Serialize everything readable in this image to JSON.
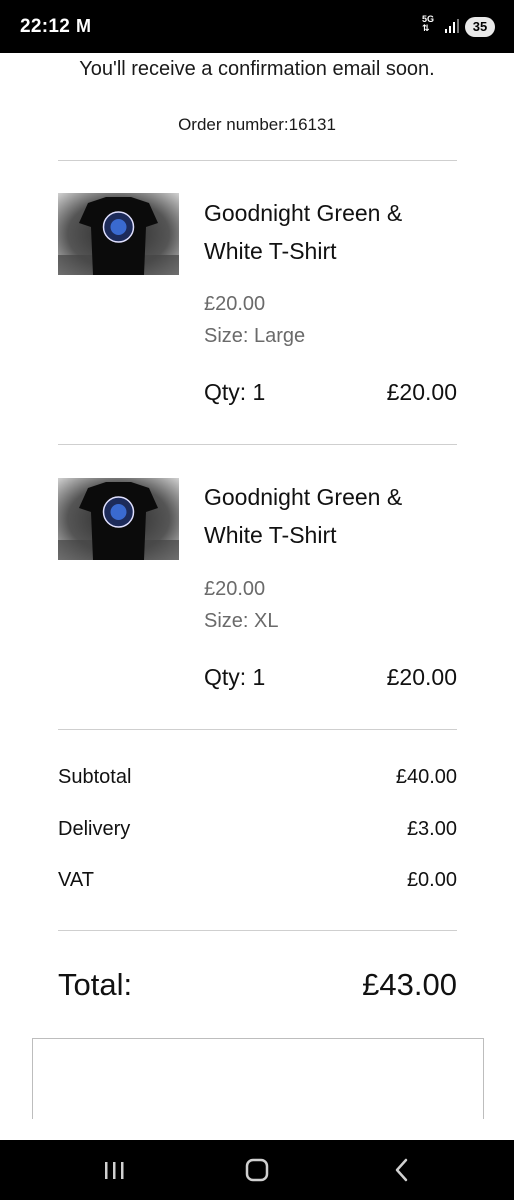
{
  "status_bar": {
    "time": "22:12",
    "notification_glyph": "M",
    "network": "5G",
    "battery": "35",
    "icons": [
      "gmail-icon",
      "signal-icon",
      "battery-icon"
    ]
  },
  "confirmation": {
    "message": "You'll receive a confirmation email soon.",
    "order_number_text": "Order number:16131"
  },
  "items": [
    {
      "title": "Goodnight Green & White T-Shirt",
      "price": "£20.00",
      "size": "Size: Large",
      "qty": "Qty: 1",
      "line_total": "£20.00"
    },
    {
      "title": "Goodnight Green & White T-Shirt",
      "price": "£20.00",
      "size": "Size: XL",
      "qty": "Qty: 1",
      "line_total": "£20.00"
    }
  ],
  "summary": {
    "subtotal_label": "Subtotal",
    "subtotal_value": "£40.00",
    "delivery_label": "Delivery",
    "delivery_value": "£3.00",
    "vat_label": "VAT",
    "vat_value": "£0.00",
    "total_label": "Total:",
    "total_value": "£43.00"
  },
  "nav_bar": {
    "icons": [
      "recent-apps-icon",
      "home-icon",
      "back-icon"
    ]
  },
  "colors": {
    "status_bar_bg": "#000000",
    "divider": "#cfcfcf",
    "muted_text": "#6a6a6a"
  }
}
